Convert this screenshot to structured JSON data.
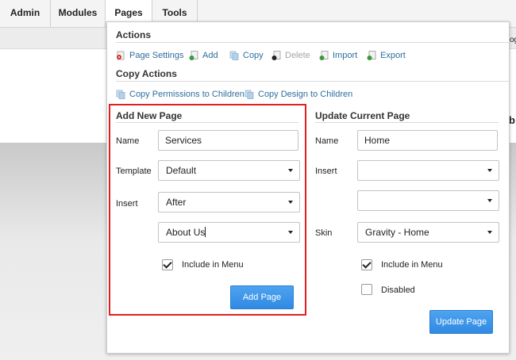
{
  "menu": {
    "items": [
      {
        "label": "Admin"
      },
      {
        "label": "Modules"
      },
      {
        "label": "Pages"
      },
      {
        "label": "Tools"
      }
    ]
  },
  "background": {
    "edge_text_1": "og",
    "edge_text_2": "b"
  },
  "actions": {
    "title": "Actions",
    "items": [
      {
        "label": "Page Settings",
        "icon": "page-settings-icon"
      },
      {
        "label": "Add",
        "icon": "add-page-icon"
      },
      {
        "label": "Copy",
        "icon": "copy-page-icon"
      },
      {
        "label": "Delete",
        "icon": "delete-page-icon",
        "disabled": true
      },
      {
        "label": "Import",
        "icon": "import-page-icon"
      },
      {
        "label": "Export",
        "icon": "export-page-icon"
      }
    ]
  },
  "copy_actions": {
    "title": "Copy Actions",
    "items": [
      {
        "label": "Copy Permissions to Children",
        "icon": "copy-permissions-icon"
      },
      {
        "label": "Copy Design to Children",
        "icon": "copy-design-icon"
      }
    ]
  },
  "add_new_page": {
    "title": "Add New Page",
    "name_label": "Name",
    "name_value": "Services",
    "template_label": "Template",
    "template_value": "Default",
    "insert_label": "Insert",
    "insert_position": "After",
    "insert_page": "About Us",
    "include_in_menu_label": "Include in Menu",
    "include_in_menu_checked": true,
    "add_button": "Add Page"
  },
  "update_current_page": {
    "title": "Update Current Page",
    "name_label": "Name",
    "name_value": "Home",
    "insert_label": "Insert",
    "insert_position": "",
    "insert_page": "",
    "skin_label": "Skin",
    "skin_value": "Gravity - Home",
    "include_in_menu_label": "Include in Menu",
    "include_in_menu_checked": true,
    "disabled_label": "Disabled",
    "disabled_checked": false,
    "update_button": "Update Page"
  },
  "colors": {
    "link": "#2e6e9e",
    "button": "#3393e8",
    "highlight_border": "#e02020"
  }
}
